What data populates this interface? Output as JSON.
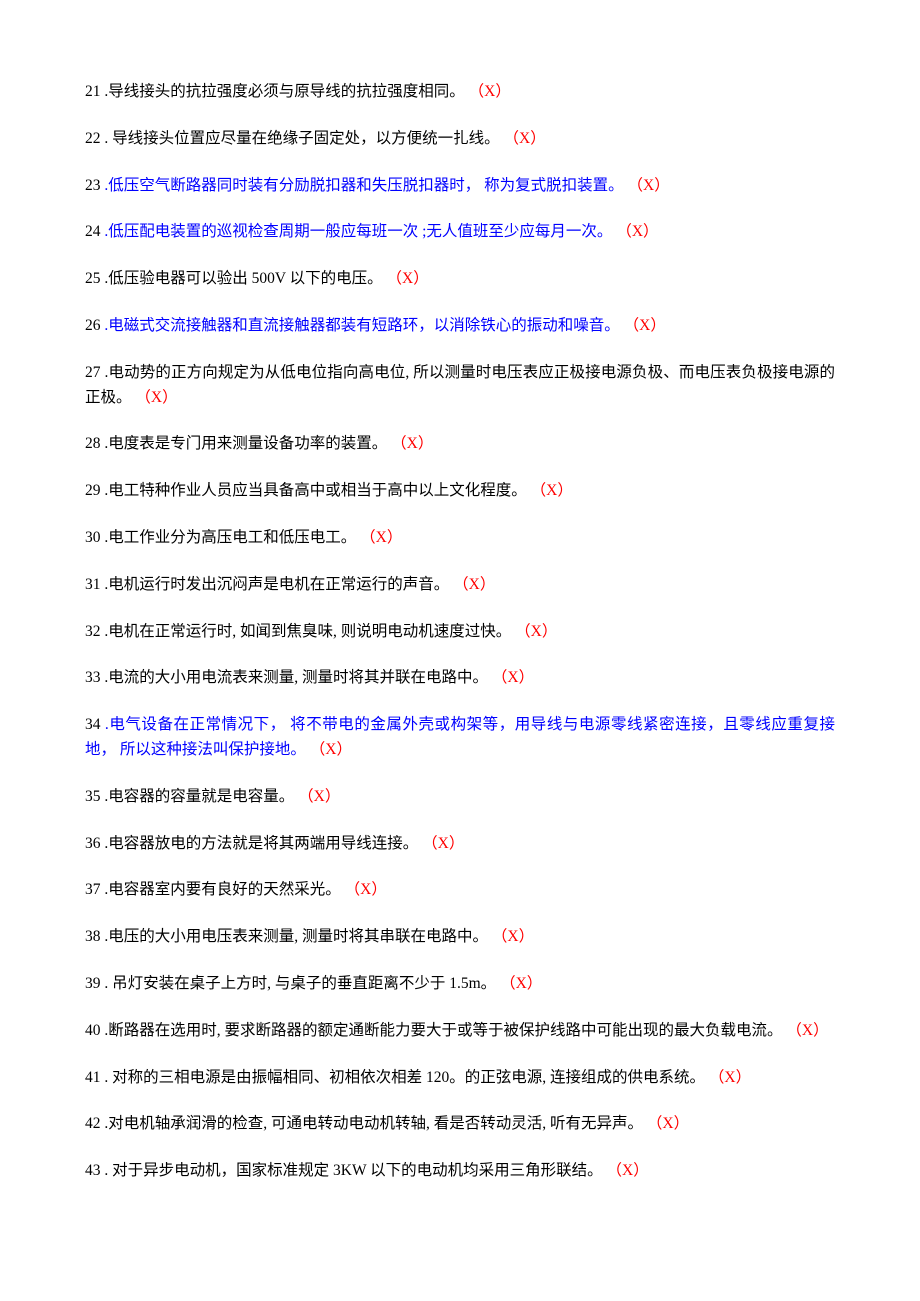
{
  "items": [
    {
      "n": "21",
      "text": "  .导线接头的抗拉强度必须与原导线的抗拉强度相同。  ",
      "mark": "（X）",
      "blue": false
    },
    {
      "n": "22",
      "text": "  . 导线接头位置应尽量在绝缘子固定处，以方便统一扎线。 ",
      "mark": "（X）",
      "blue": false
    },
    {
      "n": "23",
      "text": "  .低压空气断路器同时装有分励脱扣器和失压脱扣器时， 称为复式脱扣装置。  ",
      "mark": "（X）",
      "blue": true
    },
    {
      "n": "24",
      "text": "  .低压配电装置的巡视检查周期一般应每班一次 ;无人值班至少应每月一次。 ",
      "mark": "（X）",
      "blue": true
    },
    {
      "n": "25",
      "text": "  .低压验电器可以验出 500V 以下的电压。 ",
      "mark": "（X）",
      "blue": false
    },
    {
      "n": "26",
      "text": "  .电磁式交流接触器和直流接触器都装有短路环，以消除铁心的振动和噪音。  ",
      "mark": "（X）",
      "blue": true
    },
    {
      "n": "27",
      "text": "  .电动势的正方向规定为从低电位指向高电位, 所以测量时电压表应正极接电源负极、而电压表负极接电源的正极。 ",
      "mark": "（X）",
      "blue": false
    },
    {
      "n": "28",
      "text": "  .电度表是专门用来测量设备功率的装置。  ",
      "mark": "（X）",
      "blue": false
    },
    {
      "n": "29",
      "text": "  .电工特种作业人员应当具备高中或相当于高中以上文化程度。  ",
      "mark": "（X）",
      "blue": false
    },
    {
      "n": "30",
      "text": "  .电工作业分为高压电工和低压电工。 ",
      "mark": "（X）",
      "blue": false
    },
    {
      "n": "31",
      "text": "  .电机运行时发出沉闷声是电机在正常运行的声音。 ",
      "mark": "（X）",
      "blue": false
    },
    {
      "n": "32",
      "text": "  .电机在正常运行时, 如闻到焦臭味, 则说明电动机速度过快。  ",
      "mark": "（X）",
      "blue": false
    },
    {
      "n": "33",
      "text": "  .电流的大小用电流表来测量, 测量时将其并联在电路中。  ",
      "mark": "（X）",
      "blue": false
    },
    {
      "n": "34",
      "text": "  .电气设备在正常情况下， 将不带电的金属外壳或构架等，用导线与电源零线紧密连接，且零线应重复接地， 所以这种接法叫保护接地。 ",
      "mark": "（X）",
      "blue": true
    },
    {
      "n": "35",
      "text": "  .电容器的容量就是电容量。 ",
      "mark": "（X）",
      "blue": false
    },
    {
      "n": "36",
      "text": "  .电容器放电的方法就是将其两端用导线连接。  ",
      "mark": "（X）",
      "blue": false
    },
    {
      "n": "37",
      "text": "  .电容器室内要有良好的天然采光。 ",
      "mark": "（X）",
      "blue": false
    },
    {
      "n": "38",
      "text": "  .电压的大小用电压表来测量, 测量时将其串联在电路中。  ",
      "mark": "（X）",
      "blue": false
    },
    {
      "n": "39",
      "text": "  . 吊灯安装在桌子上方时, 与桌子的垂直距离不少于 1.5m。 ",
      "mark": "（X）",
      "blue": false
    },
    {
      "n": "40",
      "text": "  .断路器在选用时, 要求断路器的额定通断能力要大于或等于被保护线路中可能出现的最大负载电流。 ",
      "mark": "（X）",
      "blue": false
    },
    {
      "n": "41",
      "text": "  . 对称的三相电源是由振幅相同、初相依次相差 120。的正弦电源, 连接组成的供电系统。  ",
      "mark": "（X）",
      "blue": false
    },
    {
      "n": "42",
      "text": "  .对电机轴承润滑的检查, 可通电转动电动机转轴, 看是否转动灵活, 听有无异声。  ",
      "mark": "（X）",
      "blue": false
    },
    {
      "n": "43",
      "text": "  . 对于异步电动机，国家标准规定 3KW 以下的电动机均采用三角形联结。 ",
      "mark": "（X）",
      "blue": false
    }
  ]
}
